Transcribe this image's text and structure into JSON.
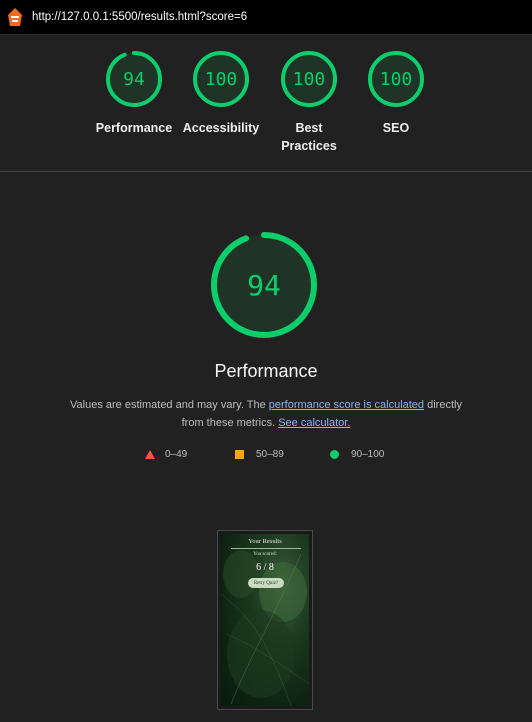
{
  "browser": {
    "url": "http://127.0.0.1:5500/results.html?score=6"
  },
  "categories": [
    {
      "label": "Performance",
      "score": "94",
      "value": 94
    },
    {
      "label": "Accessibility",
      "score": "100",
      "value": 100
    },
    {
      "label": "Best Practices",
      "score": "100",
      "value": 100
    },
    {
      "label": "SEO",
      "score": "100",
      "value": 100
    }
  ],
  "main": {
    "score": "94",
    "value": 94,
    "title": "Performance",
    "desc_prefix": "Values are estimated and may vary. The ",
    "desc_link1": "performance score is calculated",
    "desc_middle": " directly from these metrics. ",
    "desc_link2": "See calculator."
  },
  "legend": [
    {
      "label": "0–49",
      "icon": "red-triangle-icon",
      "color": "#ff4e42"
    },
    {
      "label": "50–89",
      "icon": "orange-square-icon",
      "color": "#ffa400"
    },
    {
      "label": "90–100",
      "icon": "green-circle-icon",
      "color": "#0cce6b"
    }
  ],
  "screenshot": {
    "title": "Your Results",
    "subtitle": "You scored:",
    "score": "6 / 8",
    "button": "Retry Quiz?"
  },
  "colors": {
    "pass": "#0cce6b",
    "background": "#212121"
  }
}
